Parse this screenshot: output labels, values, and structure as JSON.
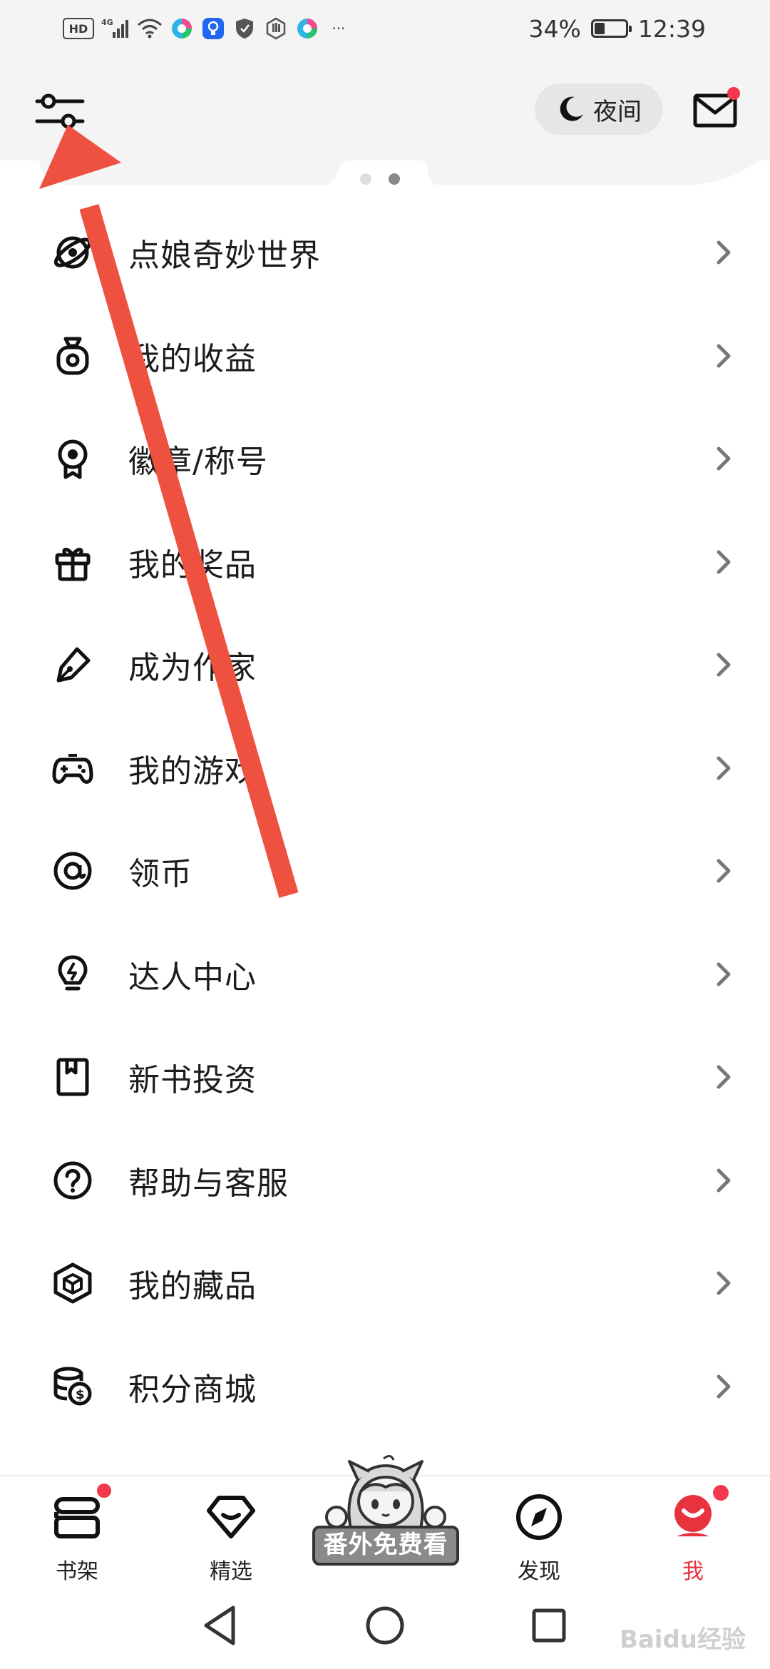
{
  "status_bar": {
    "hd_label": "HD",
    "network_label": "4G",
    "overflow": "···",
    "battery_percent": "34%",
    "battery_level": 0.34,
    "time": "12:39"
  },
  "header": {
    "night_mode_label": "夜间",
    "mail_has_badge": true
  },
  "menu": {
    "items": [
      {
        "label": "点娘奇妙世界",
        "icon": "orbit-icon"
      },
      {
        "label": "我的收益",
        "icon": "money-bag-icon"
      },
      {
        "label": "徽章/称号",
        "icon": "medal-icon"
      },
      {
        "label": "我的奖品",
        "icon": "gift-icon"
      },
      {
        "label": "成为作家",
        "icon": "pen-icon"
      },
      {
        "label": "我的游戏",
        "icon": "gamepad-icon"
      },
      {
        "label": "领币",
        "icon": "at-coin-icon"
      },
      {
        "label": "达人中心",
        "icon": "lightbulb-icon"
      },
      {
        "label": "新书投资",
        "icon": "bookmark-book-icon"
      },
      {
        "label": "帮助与客服",
        "icon": "help-icon"
      },
      {
        "label": "我的藏品",
        "icon": "cube-icon"
      },
      {
        "label": "积分商城",
        "icon": "coins-stack-icon"
      }
    ]
  },
  "tabs": {
    "bookshelf": "书架",
    "featured": "精选",
    "promo": "番外免费看",
    "discover": "发现",
    "me": "我"
  },
  "watermark": "Baidu经验",
  "colors": {
    "accent_red": "#e8333f",
    "annotation_arrow": "#ee5140",
    "header_bg": "#f4f4f4"
  }
}
